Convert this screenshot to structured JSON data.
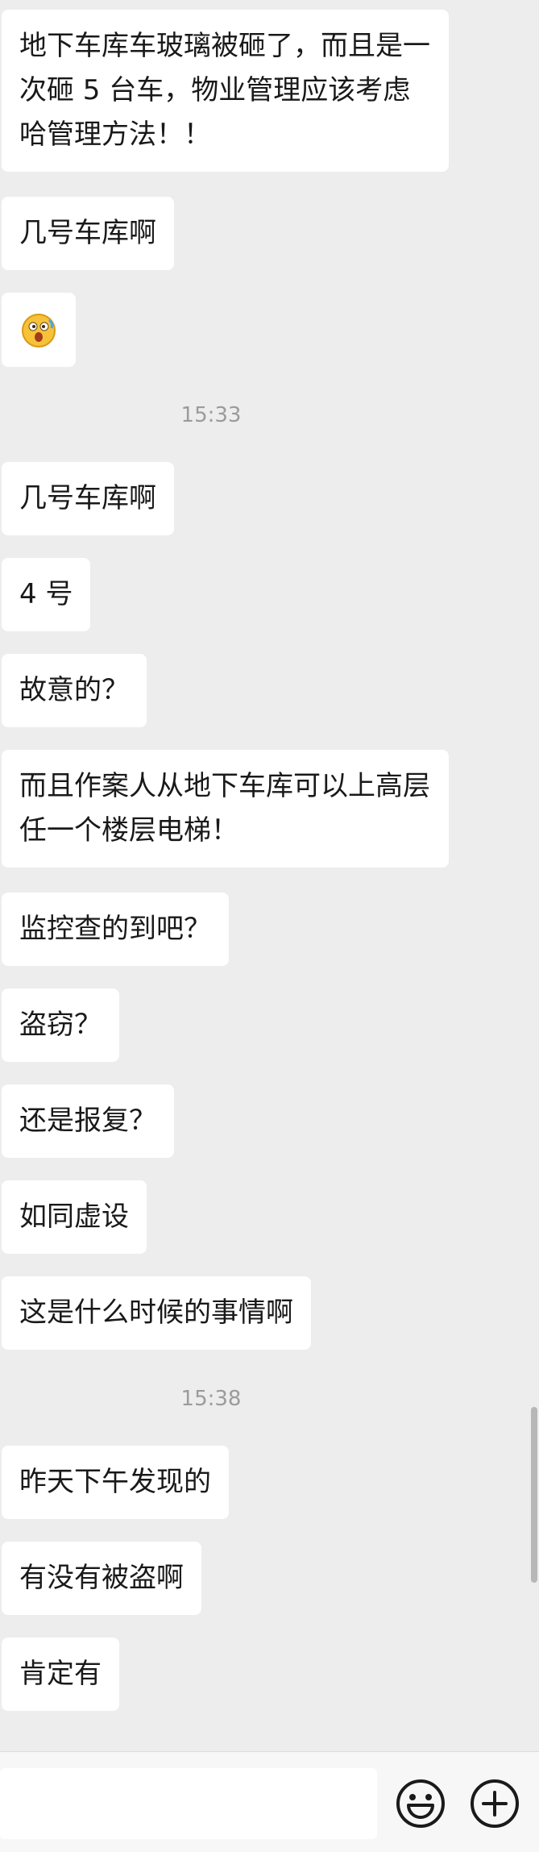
{
  "messages": [
    {
      "type": "text",
      "text": "地下车库车玻璃被砸了，而且是一次砸 5 台车，物业管理应该考虑哈管理方法！！"
    },
    {
      "type": "text",
      "text": "几号车库啊"
    },
    {
      "type": "emoji",
      "icon": "surprised-face-emoji"
    },
    {
      "type": "time",
      "text": "15:33"
    },
    {
      "type": "text",
      "text": "几号车库啊"
    },
    {
      "type": "text",
      "text": "4 号"
    },
    {
      "type": "text",
      "text": "故意的？"
    },
    {
      "type": "text",
      "text": "而且作案人从地下车库可以上高层任一个楼层电梯！"
    },
    {
      "type": "text",
      "text": "监控查的到吧？"
    },
    {
      "type": "text",
      "text": "盗窃？"
    },
    {
      "type": "text",
      "text": "还是报复？"
    },
    {
      "type": "text",
      "text": "如同虚设"
    },
    {
      "type": "text",
      "text": "这是什么时候的事情啊"
    },
    {
      "type": "time",
      "text": "15:38"
    },
    {
      "type": "text",
      "text": "昨天下午发现的"
    },
    {
      "type": "text",
      "text": "有没有被盗啊"
    },
    {
      "type": "text",
      "text": "肯定有"
    }
  ],
  "input_bar": {
    "text_value": "",
    "emoji_icon": "smiley-face-icon",
    "plus_icon": "plus-circle-icon"
  },
  "colors": {
    "background": "#ededed",
    "bubble": "#ffffff",
    "text": "#191919",
    "timestamp": "#9b9b9b"
  }
}
